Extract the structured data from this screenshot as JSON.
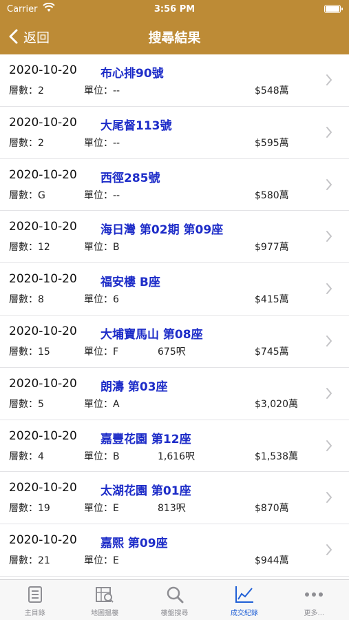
{
  "status": {
    "carrier": "Carrier",
    "time": "3:56 PM"
  },
  "nav": {
    "back_label": "返回",
    "title": "搜尋結果"
  },
  "colors": {
    "nav_bg": "#bd8b36",
    "link": "#1d2cc8",
    "tab_active": "#1f5fd6",
    "tab_inactive": "#8e8e93"
  },
  "records": [
    {
      "date": "2020-10-20",
      "name": "布心排90號",
      "floor": "層數：2",
      "unit": "單位：--",
      "area": "",
      "price": "$548萬"
    },
    {
      "date": "2020-10-20",
      "name": "大尾督113號",
      "floor": "層數：2",
      "unit": "單位：--",
      "area": "",
      "price": "$595萬"
    },
    {
      "date": "2020-10-20",
      "name": "西徑285號",
      "floor": "層數：G",
      "unit": "單位：--",
      "area": "",
      "price": "$580萬"
    },
    {
      "date": "2020-10-20",
      "name": "海日灣 第02期 第09座",
      "floor": "層數：12",
      "unit": "單位：B",
      "area": "",
      "price": "$977萬"
    },
    {
      "date": "2020-10-20",
      "name": "福安樓 B座",
      "floor": "層數：8",
      "unit": "單位：6",
      "area": "",
      "price": "$415萬"
    },
    {
      "date": "2020-10-20",
      "name": "大埔寶馬山 第08座",
      "floor": "層數：15",
      "unit": "單位：F",
      "area": "675呎",
      "price": "$745萬"
    },
    {
      "date": "2020-10-20",
      "name": "朗濤 第03座",
      "floor": "層數：5",
      "unit": "單位：A",
      "area": "",
      "price": "$3,020萬"
    },
    {
      "date": "2020-10-20",
      "name": "嘉豐花園 第12座",
      "floor": "層數：4",
      "unit": "單位：B",
      "area": "1,616呎",
      "price": "$1,538萬"
    },
    {
      "date": "2020-10-20",
      "name": "太湖花園 第01座",
      "floor": "層數：19",
      "unit": "單位：E",
      "area": "813呎",
      "price": "$870萬"
    },
    {
      "date": "2020-10-20",
      "name": "嘉熙 第09座",
      "floor": "層數：21",
      "unit": "單位：E",
      "area": "",
      "price": "$944萬"
    }
  ],
  "tabs": [
    {
      "label": "主目錄",
      "icon": "list-icon",
      "active": false
    },
    {
      "label": "地圖搵樓",
      "icon": "map-icon",
      "active": false
    },
    {
      "label": "樓盤搜尋",
      "icon": "search-icon",
      "active": false
    },
    {
      "label": "成交紀錄",
      "icon": "chart-icon",
      "active": true
    },
    {
      "label": "更多...",
      "icon": "more-icon",
      "active": false
    }
  ]
}
